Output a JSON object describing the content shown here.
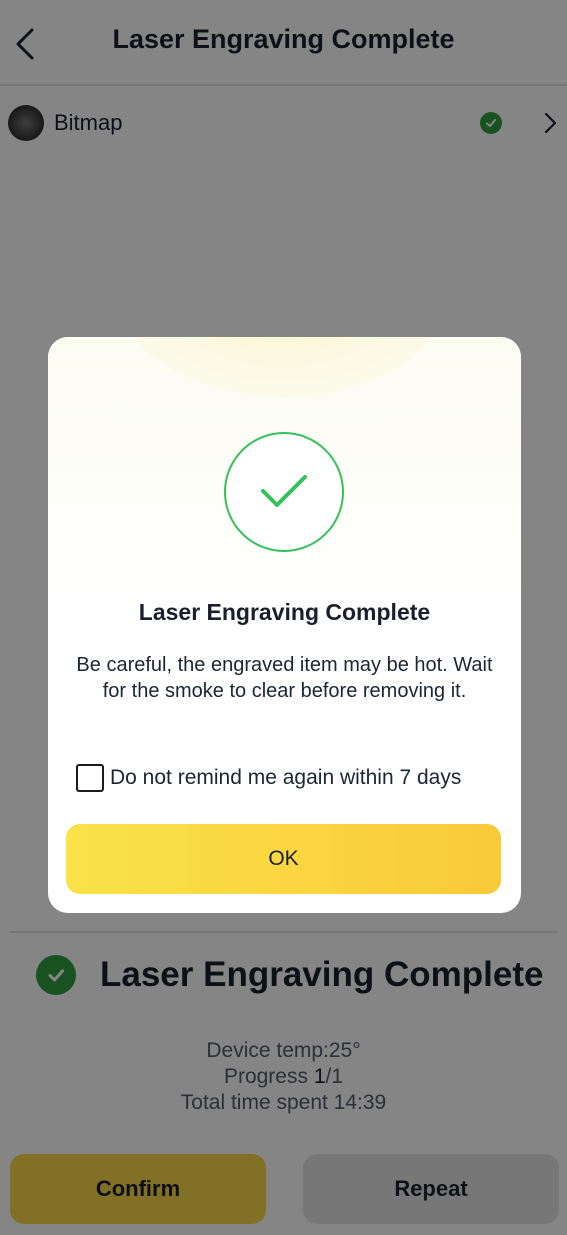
{
  "header": {
    "title": "Laser Engraving Complete"
  },
  "file_row": {
    "name": "Bitmap"
  },
  "status": {
    "text": "Laser Engraving Complete"
  },
  "stats": {
    "device_temp": "Device temp:25°",
    "progress_label": "Progress ",
    "progress_value": "1",
    "progress_total": "/1",
    "time_spent": "Total time spent 14:39"
  },
  "buttons": {
    "confirm": "Confirm",
    "repeat": "Repeat"
  },
  "dialog": {
    "title": "Laser Engraving Complete",
    "message": "Be careful, the engraved item may be hot. Wait for the smoke to clear before removing it.",
    "remind_label": "Do not remind me again within 7 days",
    "remind_checked": false,
    "ok_label": "OK"
  },
  "colors": {
    "success_green": "#2e9e3f",
    "ring_green": "#33c15a",
    "accent_yellow": "#fbd53f"
  }
}
